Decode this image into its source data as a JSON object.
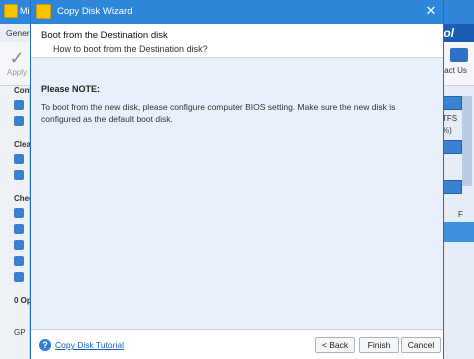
{
  "background_app": {
    "title": "Mi",
    "tabs": [
      "Genera"
    ],
    "logo_text": "ool",
    "apply_label": "Apply",
    "contact_label": "tact Us",
    "sidebar_labels": [
      "Conv",
      "Clea",
      "Chec",
      "0 Op"
    ],
    "sidebar_footer_label": "GP",
    "right_panel_texts": [
      "TFS",
      "%)",
      "F"
    ]
  },
  "dialog": {
    "title": "Copy Disk Wizard",
    "step_title": "Boot from the Destination disk",
    "step_subtitle": "How to boot from the Destination disk?",
    "note_title": "Please NOTE:",
    "note_text": "To boot from the new disk, please configure computer BIOS setting. Make sure the new disk is configured as the default boot disk.",
    "tutorial_link": "Copy Disk Tutorial",
    "buttons": {
      "back": "< Back",
      "finish": "Finish",
      "cancel": "Cancel"
    }
  },
  "colors": {
    "titlebar": "#2d86da",
    "body_bg": "#e8f1fb",
    "link": "#1a5fb4"
  }
}
